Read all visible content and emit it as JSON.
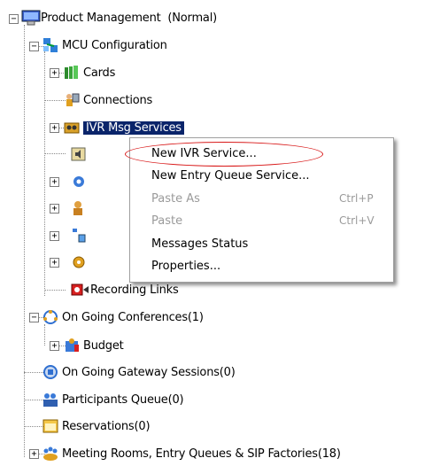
{
  "tree": {
    "root": {
      "label": "Product Management  (Normal)",
      "icon": "computer-icon"
    },
    "mcu": {
      "label": "MCU Configuration",
      "icon": "network-config-icon"
    },
    "cards": {
      "label": "Cards",
      "icon": "cards-icon"
    },
    "connections": {
      "label": "Connections",
      "icon": "connections-icon"
    },
    "ivr": {
      "label": "IVR Msg Services",
      "icon": "ivr-icon"
    },
    "recording": {
      "label": "Recording Links",
      "icon": "recording-icon"
    },
    "ongoing_conf": {
      "label": "On Going Conferences(1)",
      "icon": "conference-icon"
    },
    "budget": {
      "label": "Budget",
      "icon": "budget-icon"
    },
    "gateway": {
      "label": "On Going Gateway Sessions(0)",
      "icon": "gateway-icon"
    },
    "queue": {
      "label": "Participants Queue(0)",
      "icon": "participants-icon"
    },
    "reservations": {
      "label": "Reservations(0)",
      "icon": "calendar-icon"
    },
    "meeting_rooms": {
      "label": "Meeting Rooms, Entry Queues & SIP Factories(18)",
      "icon": "meeting-rooms-icon"
    }
  },
  "context_menu": {
    "items": [
      {
        "label": "New IVR Service...",
        "shortcut": "",
        "enabled": true
      },
      {
        "label": "New Entry Queue Service...",
        "shortcut": "",
        "enabled": true
      },
      {
        "label": "Paste As",
        "shortcut": "Ctrl+P",
        "enabled": false
      },
      {
        "label": "Paste",
        "shortcut": "Ctrl+V",
        "enabled": false
      },
      {
        "label": "Messages Status",
        "shortcut": "",
        "enabled": true
      },
      {
        "label": "Properties...",
        "shortcut": "",
        "enabled": true
      }
    ]
  },
  "colors": {
    "selection": "#0a246a",
    "highlight_oval": "#d81818"
  }
}
